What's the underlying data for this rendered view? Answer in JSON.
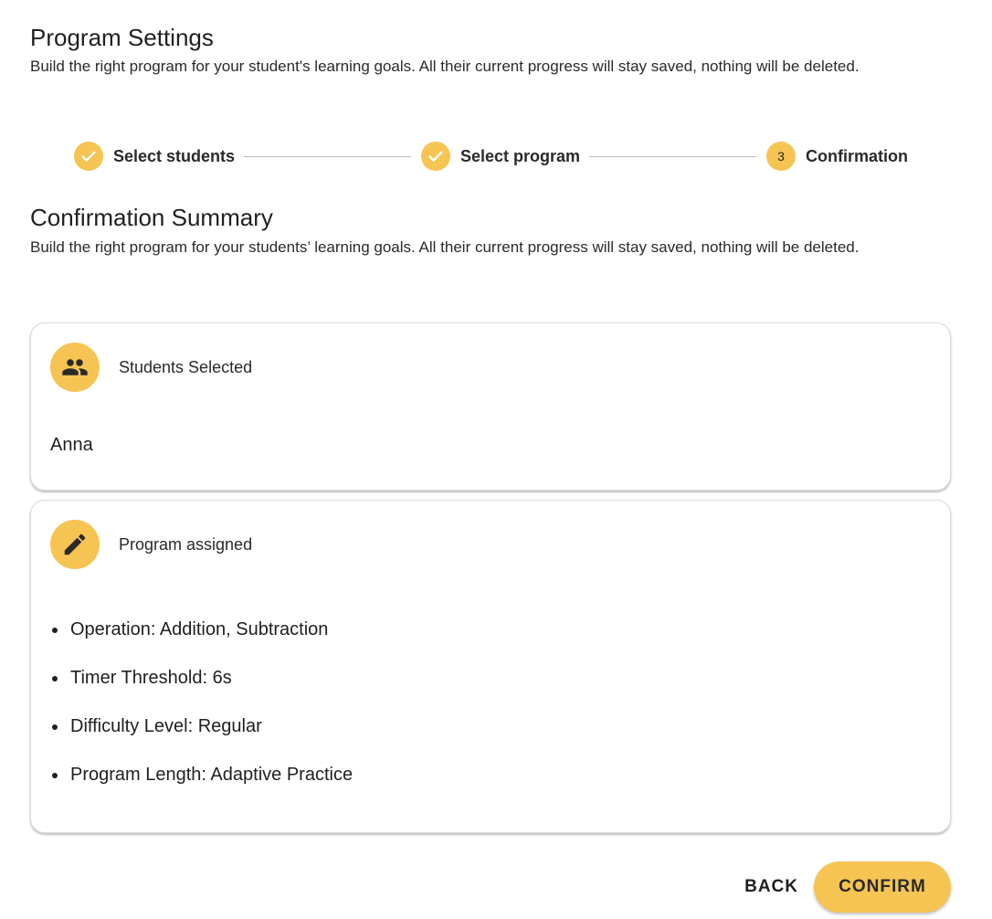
{
  "header": {
    "title": "Program Settings",
    "description": "Build the right program for your student's learning goals. All their current progress will stay saved, nothing will be deleted."
  },
  "stepper": {
    "steps": [
      {
        "label": "Select students",
        "status": "completed",
        "icon": "check-icon"
      },
      {
        "label": "Select program",
        "status": "completed",
        "icon": "check-icon"
      },
      {
        "label": "Confirmation",
        "status": "active",
        "number": "3"
      }
    ]
  },
  "summary": {
    "title": "Confirmation Summary",
    "description": "Build the right program for your students’ learning goals. All their current progress will stay saved, nothing will be deleted."
  },
  "students_card": {
    "icon": "group-icon",
    "title": "Students Selected",
    "students": "Anna"
  },
  "program_card": {
    "icon": "pencil-icon",
    "title": "Program assigned",
    "items": [
      "Operation: Addition, Subtraction",
      "Timer Threshold: 6s",
      "Difficulty Level: Regular",
      "Program Length: Adaptive Practice"
    ]
  },
  "actions": {
    "back_label": "BACK",
    "confirm_label": "CONFIRM"
  },
  "colors": {
    "accent": "#f6c453",
    "text": "#1f1f1f",
    "divider": "#bdbdbd"
  }
}
